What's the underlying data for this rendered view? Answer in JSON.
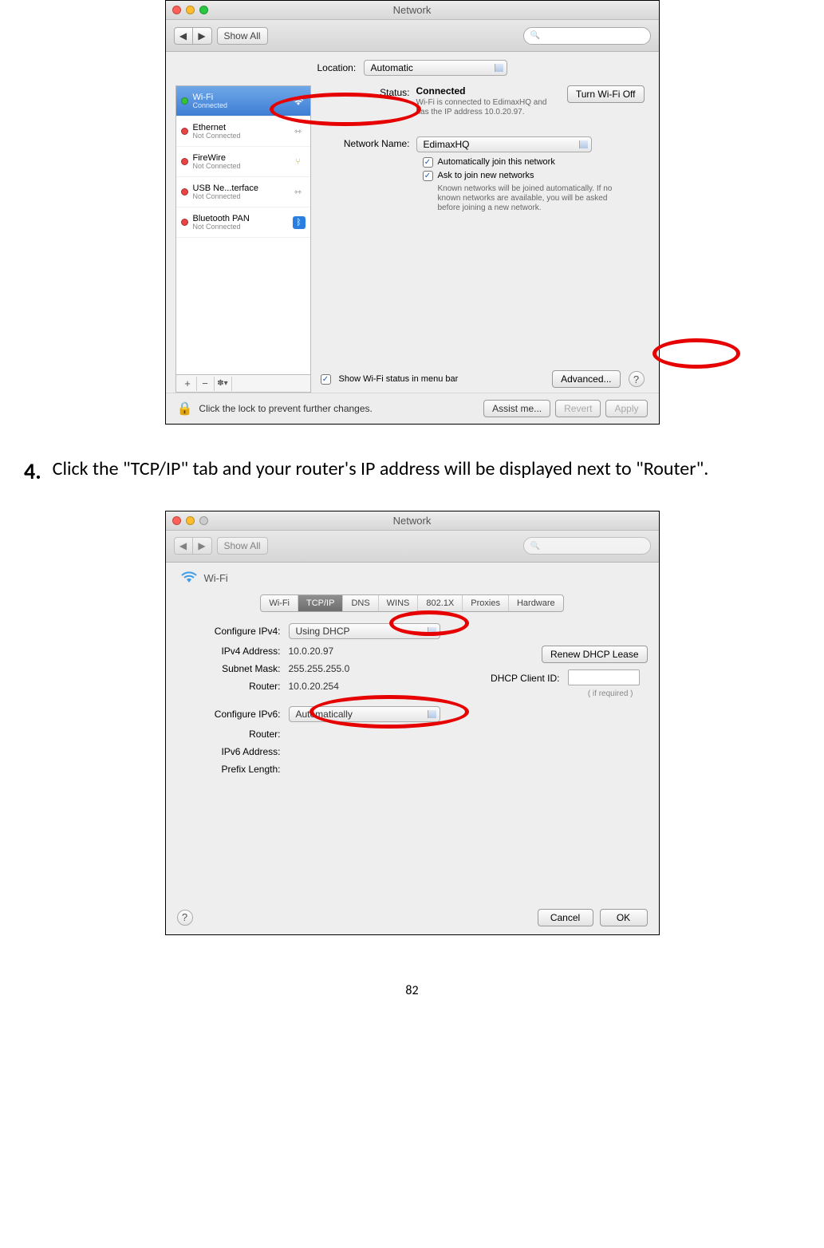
{
  "instruction": {
    "number": "4.",
    "text": "Click the \"TCP/IP\" tab and your router's IP address will be displayed next to \"Router\"."
  },
  "page_number": "82",
  "titlebar": {
    "title": "Network"
  },
  "toolbar": {
    "back_arrow": "◀",
    "fwd_arrow": "▶",
    "show_all": "Show All",
    "search_placeholder": ""
  },
  "search_icon_glyph": "🔍",
  "location": {
    "label": "Location:",
    "value": "Automatic"
  },
  "sidebar": {
    "items": [
      {
        "name": "Wi-Fi",
        "sub": "Connected",
        "status": "green"
      },
      {
        "name": "Ethernet",
        "sub": "Not Connected",
        "status": "red"
      },
      {
        "name": "FireWire",
        "sub": "Not Connected",
        "status": "red"
      },
      {
        "name": "USB Ne...terface",
        "sub": "Not Connected",
        "status": "red"
      },
      {
        "name": "Bluetooth PAN",
        "sub": "Not Connected",
        "status": "red"
      }
    ],
    "footer": {
      "plus": "+",
      "minus": "−",
      "gear": "✽▾"
    }
  },
  "detail": {
    "status_label": "Status:",
    "status_value": "Connected",
    "turn_off_button": "Turn Wi-Fi Off",
    "status_sub": "Wi-Fi is connected to EdimaxHQ and has the IP address 10.0.20.97.",
    "network_name_label": "Network Name:",
    "network_name_value": "EdimaxHQ",
    "auto_join": "Automatically join this network",
    "ask_join": "Ask to join new networks",
    "ask_join_sub": "Known networks will be joined automatically. If no known networks are available, you will be asked before joining a new network.",
    "show_status": "Show Wi-Fi status in menu bar",
    "advanced_button": "Advanced...",
    "help_glyph": "?"
  },
  "lock_row": {
    "lock_glyph": "🔒",
    "text": "Click the lock to prevent further changes.",
    "assist": "Assist me...",
    "revert": "Revert",
    "apply": "Apply"
  },
  "shot2": {
    "wifi_header": "Wi-Fi",
    "tabs": [
      "Wi-Fi",
      "TCP/IP",
      "DNS",
      "WINS",
      "802.1X",
      "Proxies",
      "Hardware"
    ],
    "configure_ipv4_label": "Configure IPv4:",
    "configure_ipv4_value": "Using DHCP",
    "ipv4_address_label": "IPv4 Address:",
    "ipv4_address_value": "10.0.20.97",
    "subnet_label": "Subnet Mask:",
    "subnet_value": "255.255.255.0",
    "router_label": "Router:",
    "router_value": "10.0.20.254",
    "renew_button": "Renew DHCP Lease",
    "dhcp_client_label": "DHCP Client ID:",
    "dhcp_client_hint": "( if required )",
    "configure_ipv6_label": "Configure IPv6:",
    "configure_ipv6_value": "Automatically",
    "router6_label": "Router:",
    "ipv6_address_label": "IPv6 Address:",
    "prefix_label": "Prefix Length:",
    "cancel": "Cancel",
    "ok": "OK"
  }
}
